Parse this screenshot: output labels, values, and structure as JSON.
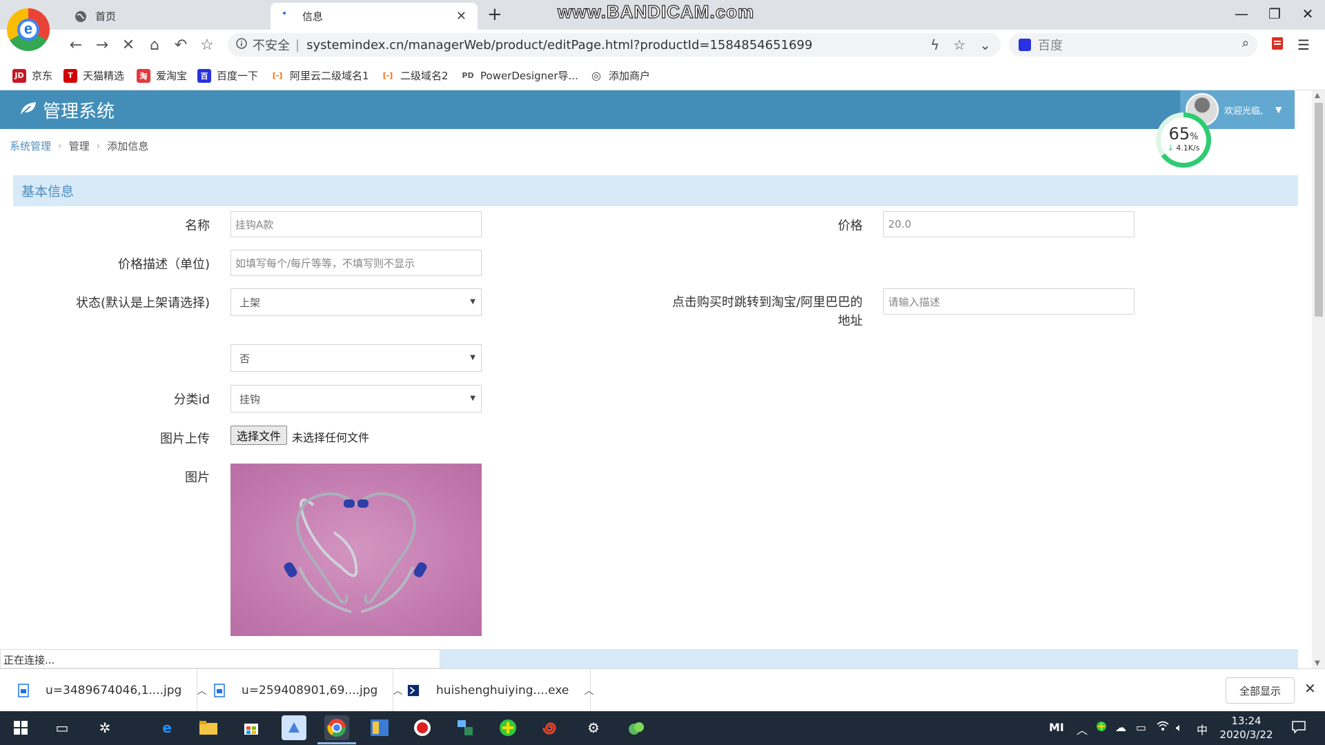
{
  "browser": {
    "tabs": [
      {
        "label": "首页",
        "active": false
      },
      {
        "label": "信息",
        "active": true
      }
    ],
    "watermark": "www.BANDICAM.com",
    "address": {
      "security": "不安全",
      "separator": "|",
      "url": "systemindex.cn/managerWeb/product/editPage.html?productId=1584854651699"
    },
    "search_engine": "百度",
    "bookmarks": [
      {
        "label": "京东",
        "icon": "JD",
        "color": "#c81623"
      },
      {
        "label": "天猫精选",
        "icon": "T",
        "color": "#d20000"
      },
      {
        "label": "爱淘宝",
        "icon": "淘",
        "color": "#e4393c"
      },
      {
        "label": "百度一下",
        "icon": "百",
        "color": "#2932e1"
      },
      {
        "label": "阿里云二级域名1",
        "icon": "[-]",
        "color": "#ff6a00"
      },
      {
        "label": "二级域名2",
        "icon": "[-]",
        "color": "#ff6a00"
      },
      {
        "label": "PowerDesigner导...",
        "icon": "PD",
        "color": "#555555"
      },
      {
        "label": "添加商户",
        "icon": "◎",
        "color": "#444444"
      }
    ]
  },
  "app": {
    "brand": "管理系统",
    "welcome": "欢迎光临,",
    "speed_widget": {
      "percent": "65",
      "percent_unit": "%",
      "rate": "4.1K/s"
    },
    "breadcrumb": [
      "系统管理",
      "管理",
      "添加信息"
    ],
    "section_title": "基本信息",
    "form": {
      "name_label": "名称",
      "name_value": "挂钩A款",
      "price_label": "价格",
      "price_value": "20.0",
      "price_desc_label": "价格描述（单位)",
      "price_desc_placeholder": "如填写每个/每斤等等，不填写则不显示",
      "status_label": "状态(默认是上架请选择)",
      "status_value": "上架",
      "jump_label_line1": "点击购买时跳转到淘宝/阿里巴巴的",
      "jump_label_line2": "地址",
      "jump_placeholder": "请输入描述",
      "second_select_value": "否",
      "category_label": "分类id",
      "category_value": "挂钩",
      "upload_label": "图片上传",
      "upload_button": "选择文件",
      "upload_status": "未选择任何文件",
      "image_label": "图片"
    },
    "status_text": "正在连接..."
  },
  "downloads": {
    "items": [
      {
        "name": "u=3489674046,1....jpg",
        "icon": "file-jpg-icon"
      },
      {
        "name": "u=259408901,69....jpg",
        "icon": "file-jpg-icon"
      },
      {
        "name": "huishenghuiying....exe",
        "icon": "file-exe-icon"
      }
    ],
    "show_all": "全部显示"
  },
  "taskbar": {
    "ime": "中",
    "time": "13:24",
    "date": "2020/3/22"
  },
  "colors": {
    "header": "#438eb9",
    "section": "#d8e9f7",
    "link": "#4c8fbd",
    "accent_green": "#2ecc71"
  }
}
